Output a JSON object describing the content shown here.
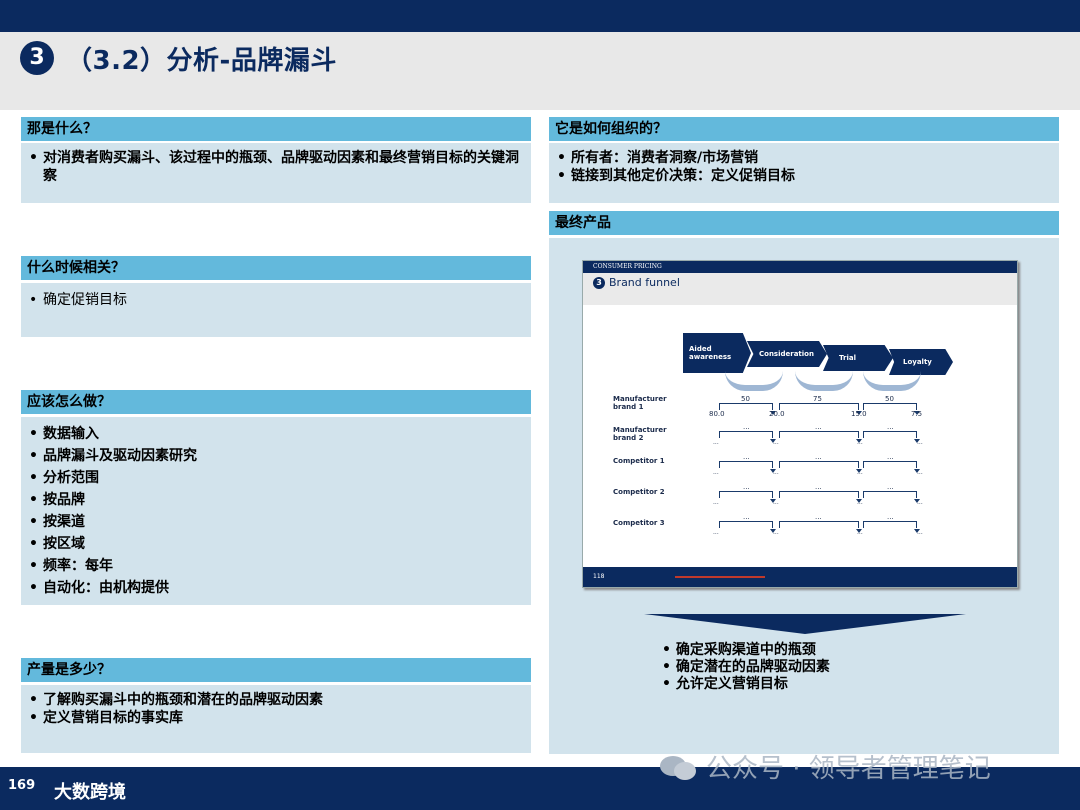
{
  "title": {
    "number": "❸",
    "text": "（3.2）分析-品牌漏斗"
  },
  "left": [
    {
      "header": "那是什么？",
      "items": [
        "对消费者购买漏斗、该过程中的瓶颈、品牌驱动因素和最终营销目标的关键洞察"
      ]
    },
    {
      "header": "什么时候相关？",
      "items": [
        "确定促销目标"
      ]
    },
    {
      "header": "应该怎么做？",
      "items": [
        "数据输入",
        "品牌漏斗及驱动因素研究",
        "分析范围",
        "按品牌",
        "按渠道",
        "按区域",
        "频率：每年",
        "自动化：由机构提供"
      ]
    },
    {
      "header": "产量是多少？",
      "items": [
        "了解购买漏斗中的瓶颈和潜在的品牌驱动因素",
        "定义营销目标的事实库"
      ]
    }
  ],
  "right": {
    "org": {
      "header": "它是如何组织的？",
      "items": [
        "所有者：消费者洞察/市场营销",
        "链接到其他定价决策：定义促销目标"
      ]
    },
    "product": {
      "header": "最终产品",
      "slide": {
        "top_label": "CONSUMER PRICING",
        "number": "3",
        "title": "Brand funnel",
        "stages": [
          "Aided awareness",
          "Consideration",
          "Trial",
          "Loyalty"
        ],
        "rows": [
          {
            "label": "Manufacturer brand 1",
            "points": [
              "80.0",
              "20.0",
              "15.0",
              "7.5"
            ],
            "conversions": [
              "50",
              "75",
              "50"
            ]
          },
          {
            "label": "Manufacturer brand 2",
            "points": [
              "...",
              "...",
              "...",
              "..."
            ],
            "conversions": [
              "...",
              "...",
              "..."
            ]
          },
          {
            "label": "Competitor 1",
            "points": [
              "...",
              "...",
              "...",
              "..."
            ],
            "conversions": [
              "...",
              "...",
              "..."
            ]
          },
          {
            "label": "Competitor 2",
            "points": [
              "...",
              "...",
              "...",
              "..."
            ],
            "conversions": [
              "...",
              "...",
              "..."
            ]
          },
          {
            "label": "Competitor 3",
            "points": [
              "...",
              "...",
              "...",
              "..."
            ],
            "conversions": [
              "...",
              "...",
              "..."
            ]
          }
        ],
        "page": "118"
      },
      "items": [
        "确定采购渠道中的瓶颈",
        "确定潜在的品牌驱动因素",
        "允许定义营销目标"
      ]
    }
  },
  "footer": {
    "logo": "169",
    "brand": "大数跨境",
    "watermark": "公众号 · 领导者管理笔记"
  },
  "colors": {
    "navy": "#0b2a5f",
    "header_blue": "#63b9dc",
    "box_bg": "#d2e3ec"
  }
}
